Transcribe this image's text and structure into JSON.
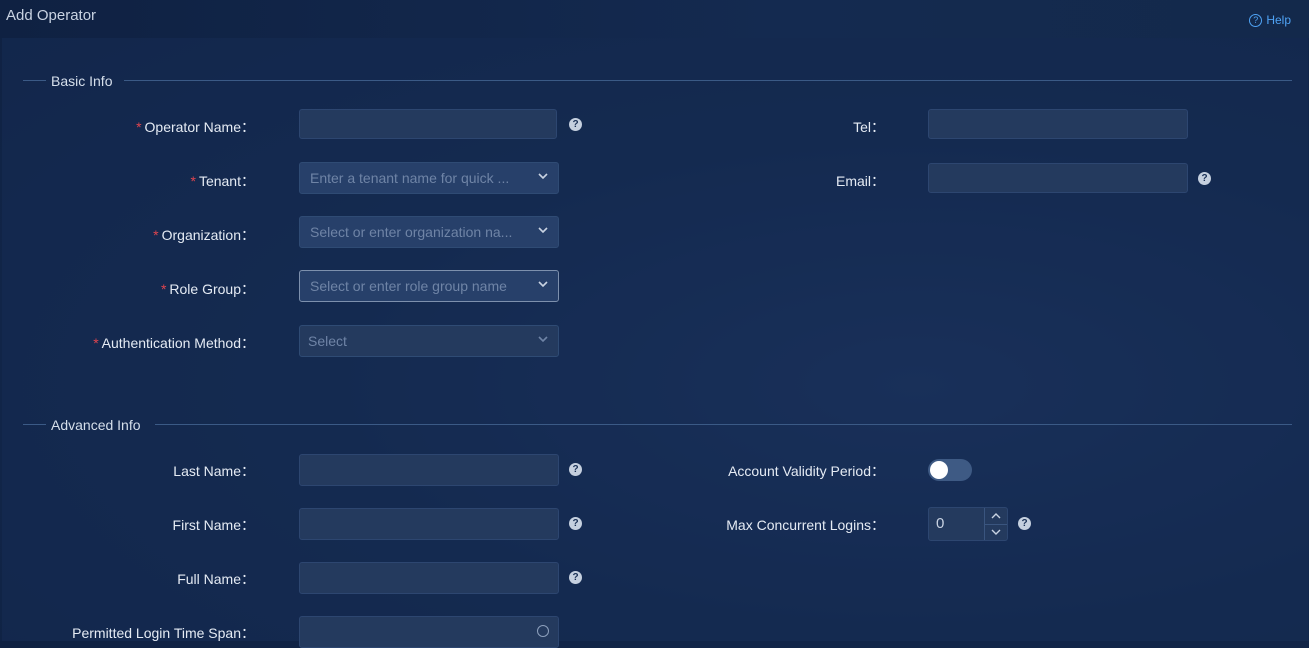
{
  "page": {
    "title": "Add Operator",
    "help_label": "Help"
  },
  "basic_info": {
    "title": "Basic Info",
    "operator_name": {
      "label": "Operator Name",
      "value": ""
    },
    "tenant": {
      "label": "Tenant",
      "placeholder": "Enter a tenant name for quick ..."
    },
    "organization": {
      "label": "Organization",
      "placeholder": "Select or enter organization na..."
    },
    "role_group": {
      "label": "Role Group",
      "placeholder": "Select or enter role group name"
    },
    "auth_method": {
      "label": "Authentication Method",
      "placeholder": "Select"
    },
    "tel": {
      "label": "Tel",
      "value": ""
    },
    "email": {
      "label": "Email",
      "value": ""
    }
  },
  "advanced_info": {
    "title": "Advanced Info",
    "last_name": {
      "label": "Last Name",
      "value": ""
    },
    "first_name": {
      "label": "First Name",
      "value": ""
    },
    "full_name": {
      "label": "Full Name",
      "value": ""
    },
    "login_time_span": {
      "label": "Permitted Login Time Span",
      "value": ""
    },
    "account_validity": {
      "label": "Account Validity Period",
      "enabled": false
    },
    "max_logins": {
      "label": "Max Concurrent Logins",
      "value": "0"
    }
  },
  "colon": "：",
  "required_mark": "*",
  "colors": {
    "accent": "#4fa3f5",
    "required": "#e0454f"
  },
  "icons": [
    "help-circle-icon",
    "question-icon",
    "chevron-down-icon",
    "chevron-up-icon",
    "clock-icon"
  ]
}
